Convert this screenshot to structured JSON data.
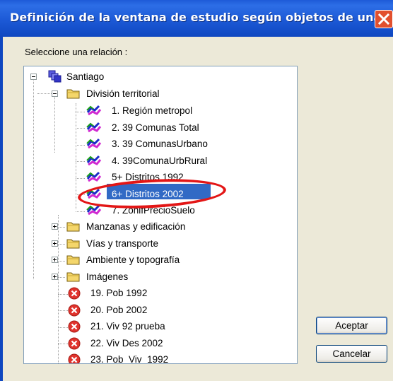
{
  "window": {
    "title": "Definición de la ventana de estudio según objetos de una re…",
    "close_icon": "close-icon"
  },
  "prompt_label": "Seleccione una relación :",
  "tree": {
    "root": {
      "label": "Santiago",
      "icon": "layers-icon"
    },
    "group1": {
      "label": "División territorial",
      "icon": "folder-icon"
    },
    "layers": [
      {
        "label": "1. Región metropol"
      },
      {
        "label": "2. 39 Comunas Total"
      },
      {
        "label": "3. 39 ComunasUrbano"
      },
      {
        "label": "4. 39ComunaUrbRural"
      },
      {
        "label": "5+ Distritos 1992"
      },
      {
        "label": "6+ Distritos 2002",
        "selected": true
      },
      {
        "label": "7. ZonifPrecioSuelo"
      }
    ],
    "folders": [
      {
        "label": "Manzanas y edificación"
      },
      {
        "label": "Vías y transporte"
      },
      {
        "label": "Ambiente y topografía"
      },
      {
        "label": "Imágenes"
      }
    ],
    "errors": [
      {
        "label": "19. Pob 1992"
      },
      {
        "label": "20. Pob 2002"
      },
      {
        "label": "21. Viv 92 prueba"
      },
      {
        "label": "22. Viv Des 2002"
      },
      {
        "label": "23. Pob_Viv_1992"
      }
    ]
  },
  "buttons": {
    "accept": "Aceptar",
    "cancel": "Cancelar"
  },
  "colors": {
    "selection": "#316AC5",
    "titlebar": "#0F47C0",
    "annotation": "#E31616",
    "error": "#E0332D"
  }
}
